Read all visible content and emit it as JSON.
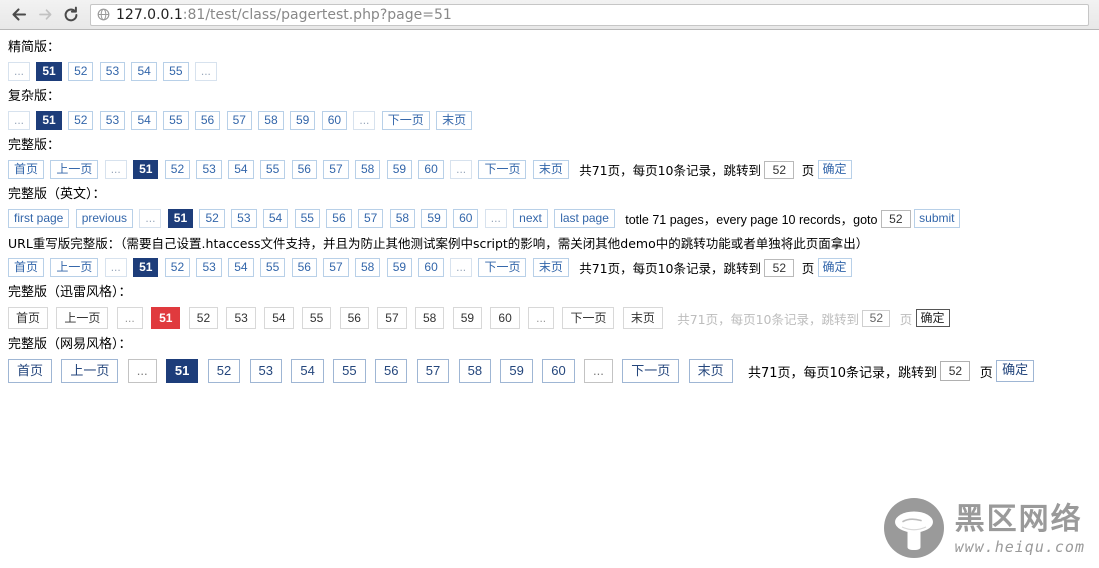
{
  "browser": {
    "back_icon": "back-arrow-icon",
    "forward_icon": "forward-arrow-icon",
    "reload_icon": "reload-icon",
    "page_icon": "globe-icon",
    "url_host": "127.0.0.1",
    "url_rest": ":81/test/class/pagertest.php?page=51",
    "url_full": "127.0.0.1:81/test/class/pagertest.php?page=51"
  },
  "sections": {
    "simple": {
      "heading": "精简版：",
      "items": [
        "...",
        "51",
        "52",
        "53",
        "54",
        "55",
        "..."
      ]
    },
    "complex": {
      "heading": "复杂版：",
      "items": [
        "...",
        "51",
        "52",
        "53",
        "54",
        "55",
        "56",
        "57",
        "58",
        "59",
        "60",
        "...",
        "下一页",
        "末页"
      ]
    },
    "full": {
      "heading": "完整版：",
      "items": [
        "首页",
        "上一页",
        "...",
        "51",
        "52",
        "53",
        "54",
        "55",
        "56",
        "57",
        "58",
        "59",
        "60",
        "...",
        "下一页",
        "末页"
      ],
      "info_before": "共71页，每页10条记录，跳转到",
      "jump_value": "52",
      "info_after": "页",
      "submit_label": "确定"
    },
    "english": {
      "heading": "完整版（英文）：",
      "items": [
        "first page",
        "previous",
        "...",
        "51",
        "52",
        "53",
        "54",
        "55",
        "56",
        "57",
        "58",
        "59",
        "60",
        "...",
        "next",
        "last page"
      ],
      "info_before": "totle 71 pages，every page 10 records，goto",
      "jump_value": "52",
      "info_after": "",
      "submit_label": "submit"
    },
    "rewrite": {
      "heading": "URL重写版完整版：（需要自己设置.htaccess文件支持，并且为防止其他测试案例中script的影响，需关闭其他demo中的跳转功能或者单独将此页面拿出）",
      "items": [
        "首页",
        "上一页",
        "...",
        "51",
        "52",
        "53",
        "54",
        "55",
        "56",
        "57",
        "58",
        "59",
        "60",
        "...",
        "下一页",
        "末页"
      ],
      "info_before": "共71页，每页10条记录，跳转到",
      "jump_value": "52",
      "info_after": "页",
      "submit_label": "确定"
    },
    "xunlei": {
      "heading": "完整版（迅雷风格）：",
      "items": [
        "首页",
        "上一页",
        "...",
        "51",
        "52",
        "53",
        "54",
        "55",
        "56",
        "57",
        "58",
        "59",
        "60",
        "...",
        "下一页",
        "末页"
      ],
      "info_before": "共71页，每页10条记录，跳转到",
      "jump_value": "52",
      "info_after": "页",
      "submit_label": "确定"
    },
    "netease": {
      "heading": "完整版（网易风格）：",
      "items": [
        "首页",
        "上一页",
        "...",
        "51",
        "52",
        "53",
        "54",
        "55",
        "56",
        "57",
        "58",
        "59",
        "60",
        "...",
        "下一页",
        "末页"
      ],
      "info_before": "共71页，每页10条记录，跳转到",
      "jump_value": "52",
      "info_after": "页",
      "submit_label": "确定"
    }
  },
  "current_page": "51",
  "colors": {
    "active_navy": "#1d3d7a",
    "active_red": "#e03a3e",
    "link_blue": "#3366aa",
    "border_blue": "#b8d0e8",
    "watermark_gray": "#9a9a9a"
  },
  "watermark": {
    "logo_icon": "mushroom-logo-icon",
    "cn": "黑区网络",
    "en": "www.heiqu.com"
  }
}
